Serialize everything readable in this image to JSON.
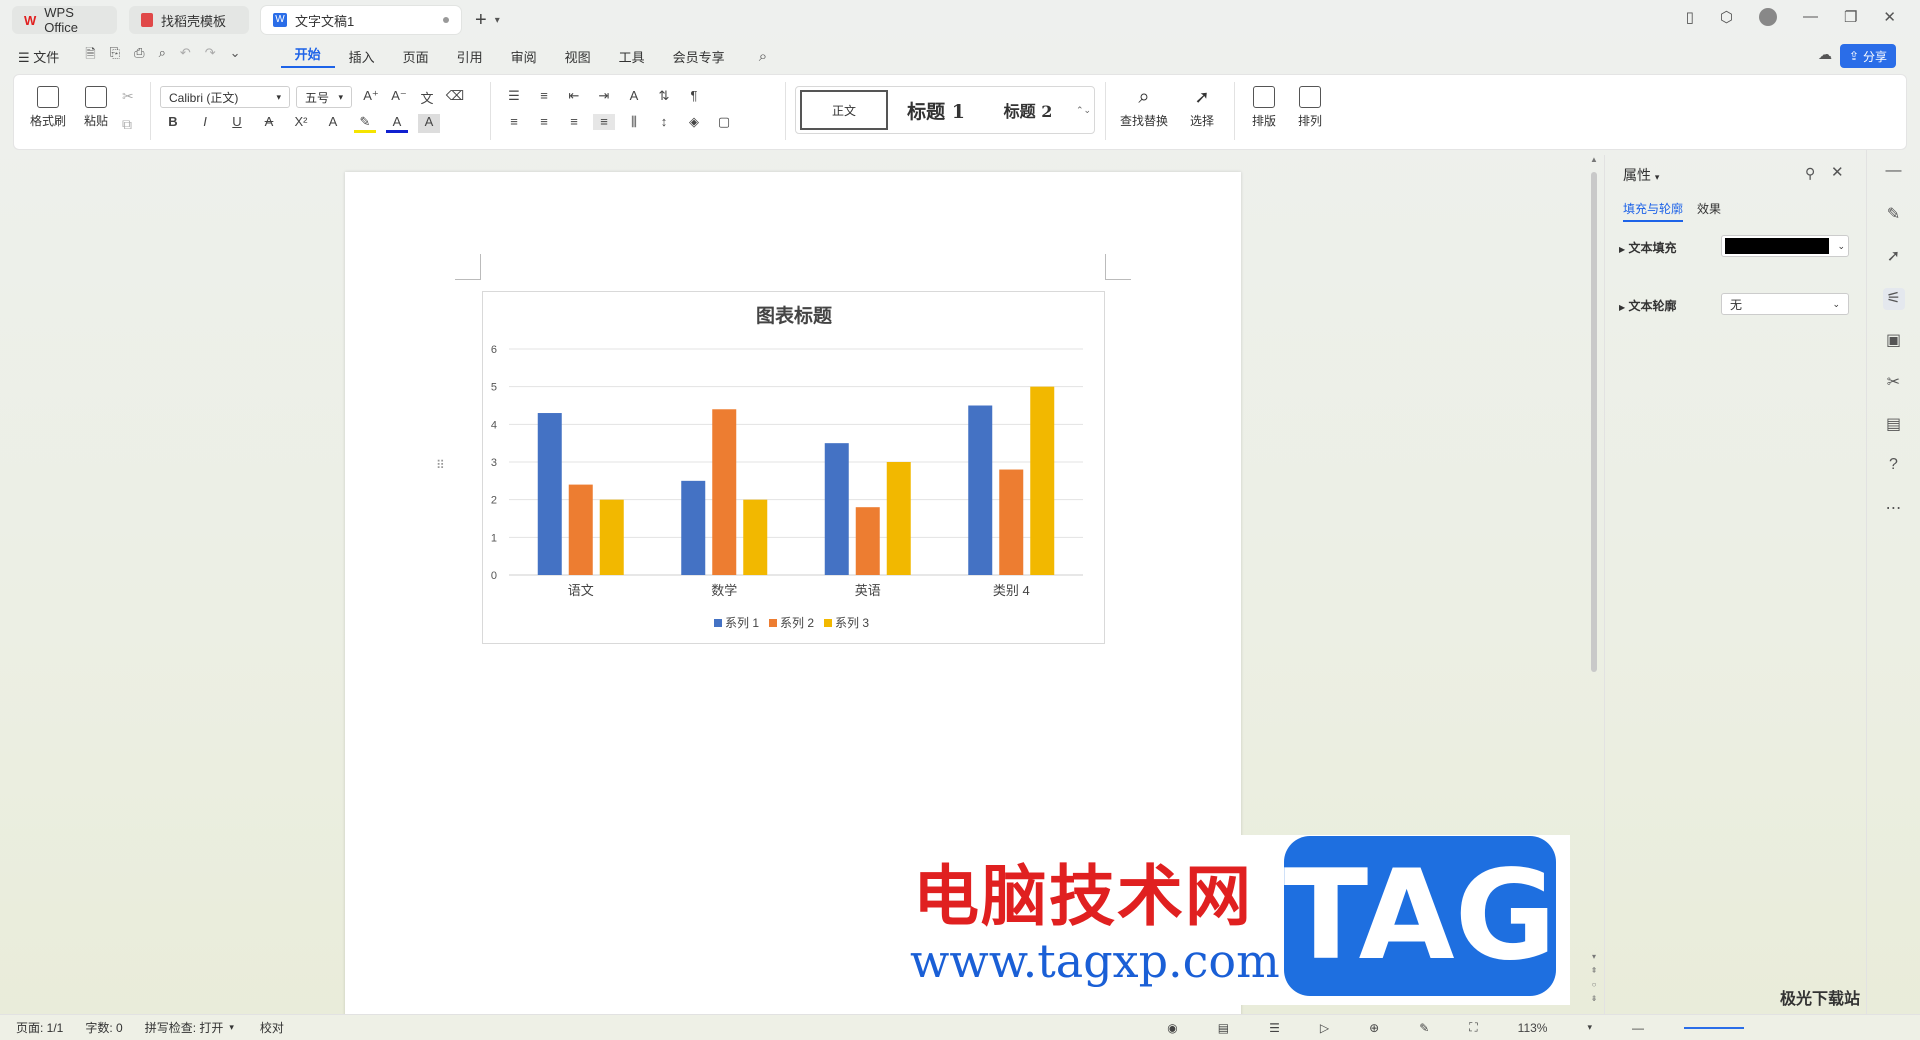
{
  "tabs": [
    {
      "label": "WPS Office",
      "color": "#e02020"
    },
    {
      "label": "找稻壳模板",
      "color": "#e04848"
    },
    {
      "label": "文字文稿1",
      "color": "#2a6de8"
    }
  ],
  "menu": {
    "file": "文件",
    "items": [
      "开始",
      "插入",
      "页面",
      "引用",
      "审阅",
      "视图",
      "工具",
      "会员专享"
    ],
    "share": "分享"
  },
  "ribbon": {
    "format_painter": "格式刷",
    "paste": "粘贴",
    "font_name": "Calibri (正文)",
    "font_size": "五号",
    "styles": [
      "正文",
      "标题 1",
      "标题 2"
    ],
    "find_replace": "查找替换",
    "select": "选择",
    "layout": "排版",
    "arrange": "排列"
  },
  "chart_data": {
    "type": "bar",
    "title": "图表标题",
    "categories": [
      "语文",
      "数学",
      "英语",
      "类别 4"
    ],
    "series": [
      {
        "name": "系列 1",
        "values": [
          4.3,
          2.5,
          3.5,
          4.5
        ],
        "color": "#4472c4"
      },
      {
        "name": "系列 2",
        "values": [
          2.4,
          4.4,
          1.8,
          2.8
        ],
        "color": "#ed7d31"
      },
      {
        "name": "系列 3",
        "values": [
          2,
          2,
          3,
          5
        ],
        "color": "#f2b800"
      }
    ],
    "ylim": [
      0,
      6
    ],
    "yticks": [
      "0",
      "1",
      "2",
      "3",
      "4",
      "5",
      "6"
    ],
    "grid": true,
    "legend": "bottom"
  },
  "panel": {
    "title": "属性",
    "tabs": [
      "填充与轮廓",
      "效果"
    ],
    "text_fill_label": "文本填充",
    "text_fill_color": "#000000",
    "text_outline_label": "文本轮廓",
    "text_outline_value": "无"
  },
  "status": {
    "page": "页面: 1/1",
    "words": "字数: 0",
    "spell": "拼写检查: 打开",
    "proof": "校对",
    "zoom": "113%"
  },
  "watermark": {
    "title": "电脑技术网",
    "url": "www.tagxp.com",
    "tag": "TAG",
    "brand": "极光下载站"
  }
}
